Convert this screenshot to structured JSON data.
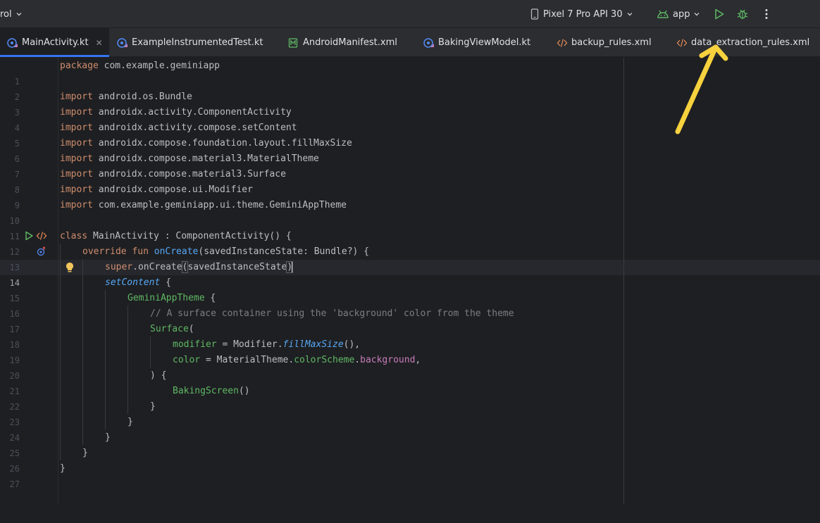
{
  "toolbar": {
    "project_label": "rol",
    "device_label": "Pixel 7 Pro API 30",
    "run_config_label": "app"
  },
  "tabs": [
    {
      "label": "MainActivity.kt",
      "active": true
    },
    {
      "label": "ExampleInstrumentedTest.kt"
    },
    {
      "label": "AndroidManifest.xml"
    },
    {
      "label": "BakingViewModel.kt"
    },
    {
      "label": "backup_rules.xml"
    },
    {
      "label": "data_extraction_rules.xml"
    }
  ],
  "editor": {
    "current_line": 14,
    "line_numbers": [
      "1",
      "2",
      "3",
      "4",
      "5",
      "6",
      "7",
      "8",
      "9",
      "10",
      "11",
      "12",
      "13",
      "14",
      "15",
      "16",
      "17",
      "18",
      "19",
      "20",
      "21",
      "22",
      "23",
      "24",
      "25",
      "26",
      "27"
    ],
    "lines": {
      "l1": {
        "kw": "package",
        "rest": " com.example.geminiapp"
      },
      "l3": {
        "kw": "import",
        "rest": " android.os.Bundle"
      },
      "l4": {
        "kw": "import",
        "rest": " androidx.activity.ComponentActivity"
      },
      "l5": {
        "kw": "import",
        "rest": " androidx.activity.compose.setContent"
      },
      "l6": {
        "kw": "import",
        "rest": " androidx.compose.foundation.layout.fillMaxSize"
      },
      "l7": {
        "kw": "import",
        "rest": " androidx.compose.material3.MaterialTheme"
      },
      "l8": {
        "kw": "import",
        "rest": " androidx.compose.material3.Surface"
      },
      "l9": {
        "kw": "import",
        "rest": " androidx.compose.ui.Modifier"
      },
      "l10": {
        "kw": "import",
        "rest": " com.example.geminiapp.ui.theme.GeminiAppTheme"
      },
      "l12": {
        "kw": "class",
        "rest": " MainActivity : ComponentActivity() {"
      },
      "l13": {
        "kw": "override fun",
        "fn": "onCreate",
        "rest": "(savedInstanceState: Bundle?) {"
      },
      "l14": {
        "kw": "super",
        "rest1": ".onCreate",
        "paren_open": "(",
        "arg": "savedInstanceState",
        "paren_close": ")"
      },
      "l15": {
        "fn": "setContent",
        "rest": " {"
      },
      "l16": {
        "cls": "GeminiAppTheme",
        "rest": " {"
      },
      "l17": {
        "comment": "// A surface container using the 'background' color from the theme"
      },
      "l18": {
        "cls": "Surface",
        "rest": "("
      },
      "l19": {
        "param": "modifier",
        "eq": " = Modifier.",
        "fn": "fillMaxSize",
        "rest": "(),"
      },
      "l20": {
        "param": "color",
        "eq": " = MaterialTheme.",
        "prop1": "colorScheme",
        "dot": ".",
        "prop2": "background",
        "rest": ","
      },
      "l21": {
        "rest": ") {"
      },
      "l22": {
        "cls": "BakingScreen",
        "rest": "()"
      },
      "l23": {
        "rest": "}"
      },
      "l24": {
        "rest": "}"
      },
      "l25": {
        "rest": "}"
      },
      "l26": {
        "rest": "}"
      },
      "l27": {
        "rest": "}"
      }
    }
  },
  "colors": {
    "accent": "#3574f0",
    "annotation_arrow": "#f7d23e",
    "run_green": "#5fb865"
  }
}
